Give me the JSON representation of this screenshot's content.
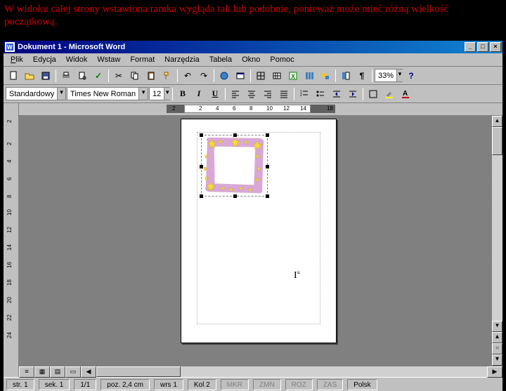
{
  "caption": "W widoku całej strony wstawiona ramka wygląda tak lub podobnie, ponieważ może mieć różną wielkość początkową.",
  "window": {
    "title": "Dokument 1 - Microsoft Word"
  },
  "menu": {
    "file": "Plik",
    "edit": "Edycja",
    "view": "Widok",
    "insert": "Wstaw",
    "format": "Format",
    "tools": "Narzędzia",
    "table": "Tabela",
    "window": "Okno",
    "help": "Pomoc"
  },
  "toolbar": {
    "zoom": "33%",
    "style": "Standardowy",
    "font": "Times New Roman",
    "size": "12",
    "font_color": "#cc0000",
    "highlight_color": "#ffff00"
  },
  "ruler": {
    "h": [
      "2",
      "2",
      "4",
      "6",
      "8",
      "10",
      "12",
      "14",
      "18"
    ],
    "v": [
      "2",
      "2",
      "4",
      "6",
      "8",
      "10",
      "12",
      "14",
      "16",
      "18",
      "20",
      "22",
      "24"
    ]
  },
  "status": {
    "page": "str. 1",
    "section": "sek. 1",
    "pages": "1/1",
    "position": "poz. 2,4 cm",
    "line": "wrs 1",
    "column": "Kol 2",
    "ind_mkr": "MKR",
    "ind_zmn": "ZMN",
    "ind_roz": "ROZ",
    "ind_zas": "ZAS",
    "lang": "Polsk"
  }
}
